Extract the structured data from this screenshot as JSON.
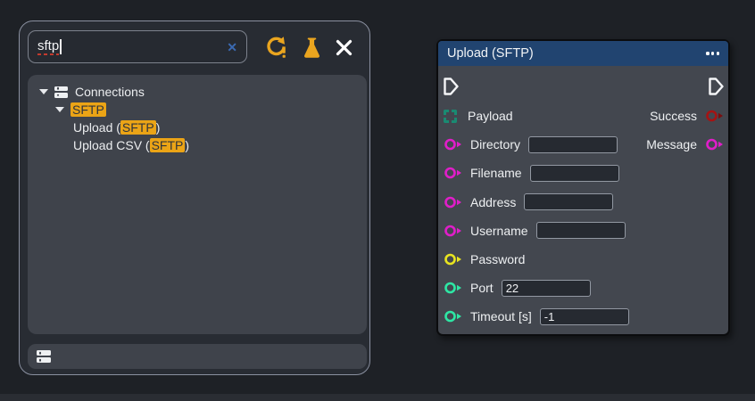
{
  "palette": {
    "search": {
      "value": "sftp"
    },
    "toolbar": {
      "icons": [
        "refresh-alert-icon",
        "flask-icon",
        "close-icon"
      ]
    },
    "tree": {
      "highlight_color": "#eba416",
      "items": [
        {
          "indent": 0,
          "caret": true,
          "icon": "server-icon",
          "segments": [
            {
              "text": "Connections",
              "highlight": false
            }
          ]
        },
        {
          "indent": 1,
          "caret": true,
          "segments": [
            {
              "text": "SFTP",
              "highlight": true
            }
          ]
        },
        {
          "indent": 2,
          "caret": false,
          "segments": [
            {
              "text": "Upload (",
              "highlight": false
            },
            {
              "text": "SFTP",
              "highlight": true
            },
            {
              "text": ")",
              "highlight": false
            }
          ]
        },
        {
          "indent": 2,
          "caret": false,
          "segments": [
            {
              "text": "Upload CSV (",
              "highlight": false
            },
            {
              "text": "SFTP",
              "highlight": true
            },
            {
              "text": ")",
              "highlight": false
            }
          ]
        }
      ]
    },
    "footer_icon": "server-icon"
  },
  "node": {
    "title": "Upload (SFTP)",
    "header_color": "#214470",
    "menu_icon": "ellipsis-icon",
    "exec_in_icon": "exec-arrow-icon",
    "exec_out_icon": "exec-arrow-icon",
    "inputs": [
      {
        "label": "Payload",
        "port_shape": "dashed-square",
        "port_color": "#1a8a72"
      },
      {
        "label": "Directory",
        "port_shape": "circle",
        "port_color": "#e01ec9",
        "field": {
          "value": ""
        }
      },
      {
        "label": "Filename",
        "port_shape": "circle",
        "port_color": "#e01ec9",
        "field": {
          "value": ""
        }
      },
      {
        "label": "Address",
        "port_shape": "circle",
        "port_color": "#e01ec9",
        "field": {
          "value": ""
        }
      },
      {
        "label": "Username",
        "port_shape": "circle",
        "port_color": "#e01ec9",
        "field": {
          "value": ""
        }
      },
      {
        "label": "Password",
        "port_shape": "circle",
        "port_color": "#e8e420"
      },
      {
        "label": "Port",
        "port_shape": "circle",
        "port_color": "#2ee6a4",
        "field": {
          "value": "22"
        }
      },
      {
        "label": "Timeout [s]",
        "port_shape": "circle",
        "port_color": "#2ee6a4",
        "field": {
          "value": "-1"
        }
      }
    ],
    "outputs": [
      {
        "label": "Success",
        "port_color": "#a51313",
        "arrow_color": "#7a0e0e"
      },
      {
        "label": "Message",
        "port_color": "#e01ec9"
      }
    ]
  }
}
